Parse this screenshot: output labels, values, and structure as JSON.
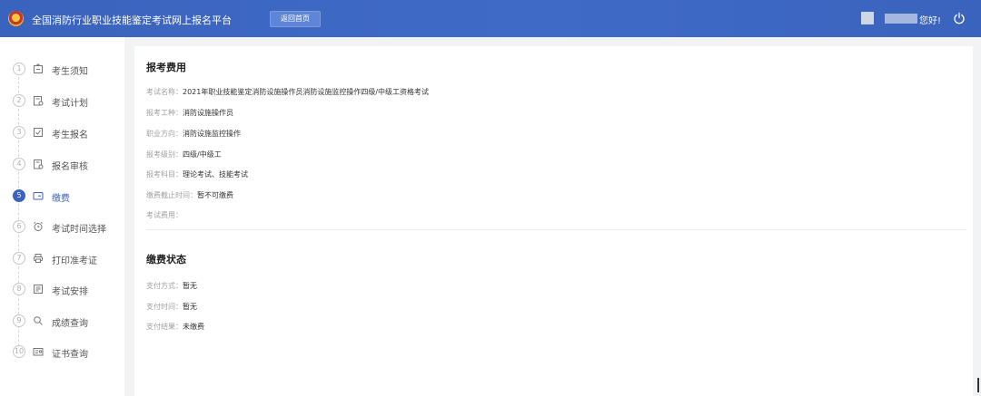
{
  "header": {
    "title": "全国消防行业职业技能鉴定考试网上报名平台",
    "home_button": "返回首页",
    "greeting": "您好!",
    "brand_color": "#3a63bd"
  },
  "sidebar": {
    "steps": [
      {
        "num": "1",
        "label": "考生须知",
        "icon": "notice-icon"
      },
      {
        "num": "2",
        "label": "考试计划",
        "icon": "plan-icon"
      },
      {
        "num": "3",
        "label": "考生报名",
        "icon": "register-icon"
      },
      {
        "num": "4",
        "label": "报名审核",
        "icon": "review-icon"
      },
      {
        "num": "5",
        "label": "缴费",
        "icon": "payment-icon",
        "active": true
      },
      {
        "num": "6",
        "label": "考试时间选择",
        "icon": "alarm-clock-icon"
      },
      {
        "num": "7",
        "label": "打印准考证",
        "icon": "printer-icon"
      },
      {
        "num": "8",
        "label": "考试安排",
        "icon": "schedule-icon"
      },
      {
        "num": "9",
        "label": "成绩查询",
        "icon": "search-icon"
      },
      {
        "num": "10",
        "label": "证书查询",
        "icon": "certificate-icon"
      }
    ]
  },
  "fee": {
    "title": "报考费用",
    "rows": [
      {
        "key": "考试名称：",
        "value": "2021年职业技能鉴定消防设施操作员消防设施监控操作四级/中级工资格考试"
      },
      {
        "key": "报考工种：",
        "value": "消防设施操作员"
      },
      {
        "key": "职业方向：",
        "value": "消防设施监控操作"
      },
      {
        "key": "报考级别：",
        "value": "四级/中级工"
      },
      {
        "key": "报考科目：",
        "value": "理论考试、技能考试"
      },
      {
        "key": "缴费截止时间：",
        "value": "暂不可缴费"
      },
      {
        "key": "考试费用：",
        "value": ""
      }
    ]
  },
  "payment": {
    "title": "缴费状态",
    "rows": [
      {
        "key": "支付方式：",
        "value": "暂无"
      },
      {
        "key": "支付时间：",
        "value": "暂无"
      },
      {
        "key": "支付结果：",
        "value": "未缴费"
      }
    ]
  }
}
